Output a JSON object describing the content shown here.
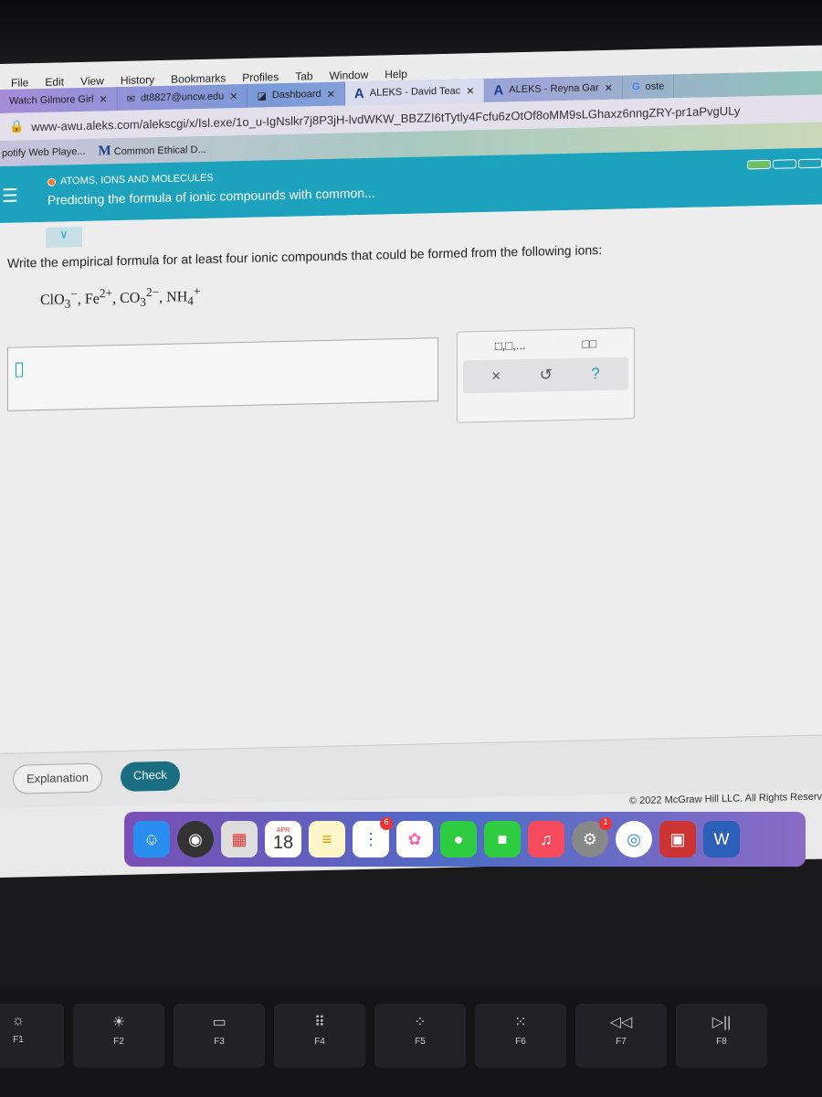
{
  "menubar": [
    "File",
    "Edit",
    "View",
    "History",
    "Bookmarks",
    "Profiles",
    "Tab",
    "Window",
    "Help"
  ],
  "tabs": [
    {
      "label": "Watch Gilmore Girl"
    },
    {
      "label": "dt8827@uncw.edu"
    },
    {
      "label": "Dashboard"
    },
    {
      "label": "ALEKS - David Teac"
    },
    {
      "label": "ALEKS - Reyna Gar"
    },
    {
      "label": "oste"
    }
  ],
  "url": "www-awu.aleks.com/alekscgi/x/Isl.exe/1o_u-IgNslkr7j8P3jH-lvdWKW_BBZZI6tTytly4Fcfu6zOtOf8oMM9sLGhaxz6nngZRY-pr1aPvgULy",
  "bookmarks": [
    "potify Web Playe...",
    "Common Ethical D..."
  ],
  "header": {
    "topic": "ATOMS, IONS AND MOLECULES",
    "lesson": "Predicting the formula of ionic compounds with common...",
    "progress_filled": 1,
    "progress_total": 3,
    "accent": "#1da2bd"
  },
  "question": {
    "prompt": "Write the empirical formula for at least four ionic compounds that could be formed from the following ions:",
    "ions": [
      {
        "base": "ClO",
        "sub": "3",
        "sup": "−"
      },
      {
        "base": "Fe",
        "sub": "",
        "sup": "2+"
      },
      {
        "base": "CO",
        "sub": "3",
        "sup": "2−"
      },
      {
        "base": "NH",
        "sub": "4",
        "sup": "+"
      }
    ]
  },
  "palette": {
    "sequence": "□,□,...",
    "subscript": "□□",
    "clear": "×",
    "undo": "↺",
    "help": "?"
  },
  "footer": {
    "explanation": "Explanation",
    "check": "Check",
    "copyright": "© 2022 McGraw Hill LLC. All Rights Reserv"
  },
  "dock": {
    "calendar_month": "APR",
    "calendar_day": "18",
    "reminders_badge": "6",
    "settings_badge": "1"
  },
  "keys": [
    {
      "label": "F1"
    },
    {
      "label": "F2"
    },
    {
      "label": "F3"
    },
    {
      "label": "F4"
    },
    {
      "label": "F5"
    },
    {
      "label": "F6"
    },
    {
      "label": "F7"
    },
    {
      "label": "F8"
    }
  ]
}
